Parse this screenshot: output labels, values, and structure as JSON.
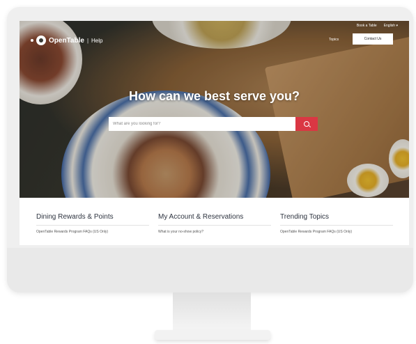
{
  "header": {
    "brand": "OpenTable",
    "separator": "|",
    "help": "Help",
    "top_links": [
      "Book a Table",
      "English"
    ],
    "topics": "Topics",
    "contact_button": "Contact Us"
  },
  "hero": {
    "title": "How can we best serve you?",
    "search_placeholder": "What are you looking for?"
  },
  "columns": [
    {
      "title": "Dining Rewards & Points",
      "link": "OpenTable Rewards Program FAQs (US Only)"
    },
    {
      "title": "My Account & Reservations",
      "link": "What is your no-show policy?"
    },
    {
      "title": "Trending Topics",
      "link": "OpenTable Rewards Program FAQs (US Only)"
    }
  ],
  "colors": {
    "accent": "#da3743"
  },
  "icons": [
    "search-icon",
    "chevron-down-icon"
  ]
}
